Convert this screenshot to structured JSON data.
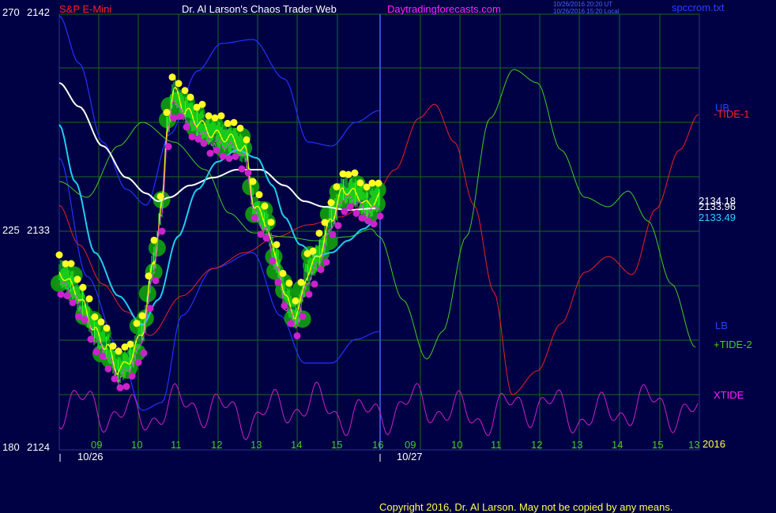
{
  "header": {
    "symbol": "S&P E-Mini",
    "title": "Dr. Al Larson's Chaos Trader Web",
    "site": "Daytradingforecasts.com",
    "ts_ut": "10/26/2016 20:20 UT",
    "ts_local": "10/26/2016 15:20 Local",
    "file": "spccrom.txt"
  },
  "axis_left": {
    "top": {
      "a": "270",
      "b": "2142"
    },
    "mid": {
      "a": "225",
      "b": "2133"
    },
    "bottom": {
      "a": "180",
      "b": "2124"
    }
  },
  "hour_labels": [
    "09",
    "10",
    "11",
    "12",
    "13",
    "14",
    "15",
    "16",
    "09",
    "10",
    "11",
    "12",
    "13",
    "14",
    "15",
    "13"
  ],
  "date_labels": [
    "10/26",
    "10/27"
  ],
  "year_label": "2016",
  "right_labels": {
    "ub": "UB",
    "tide1": "-TIDE-1",
    "lb": "LB",
    "tide2": "+TIDE-2",
    "xtide": "XTIDE"
  },
  "price_labels": [
    "2134.18",
    "2133.96",
    "2133.49"
  ],
  "copyright": "Copyright 2016, Dr. Al Larson. May not be copied by any means.",
  "colors": {
    "background": "#000044",
    "grid": "#1a6a1a",
    "price": "#00ff00",
    "white_ma": "#ffffff",
    "cyan_ma": "#22ccee",
    "yellow_ma": "#ffff00",
    "band": "#2233ff",
    "tide1": "#ee2222",
    "tide2": "#44cc22",
    "xtide": "#cc22cc",
    "text_red": "#ff2222",
    "text_magenta": "#ff22ff",
    "text_yellow": "#ffff44",
    "text_cyan": "#33ccff"
  },
  "chart_data": {
    "type": "line",
    "title": "S&P E-Mini",
    "y_left_range": [
      2124,
      2142
    ],
    "y_osc_range": [
      180,
      270
    ],
    "x_hours_day1": [
      9,
      10,
      11,
      12,
      13,
      14,
      15,
      16
    ],
    "series": [
      {
        "name": "price (S&P E-Mini)",
        "hour": [
          8.0,
          8.5,
          9.0,
          9.5,
          10.0,
          10.5,
          10.8,
          11.0,
          11.5,
          12.0,
          12.5,
          13.0,
          13.5,
          14.0,
          14.5,
          15.0,
          15.5,
          16.0
        ],
        "values": [
          2131.5,
          2130.0,
          2129.5,
          2127.5,
          2129.0,
          2136.0,
          2140.0,
          2138.0,
          2137.0,
          2137.5,
          2136.5,
          2134.0,
          2131.0,
          2129.5,
          2131.5,
          2133.0,
          2134.0,
          2134.0
        ]
      },
      {
        "name": "-TIDE-1",
        "values": "projected oscillator, extends through 10/27"
      },
      {
        "name": "+TIDE-2",
        "values": "projected oscillator, extends through 10/27"
      },
      {
        "name": "XTIDE",
        "values": "projected oscillator, extends through 10/27"
      }
    ],
    "last_values": {
      "white": 2134.18,
      "yellow": 2133.96,
      "cyan": 2133.49
    }
  }
}
